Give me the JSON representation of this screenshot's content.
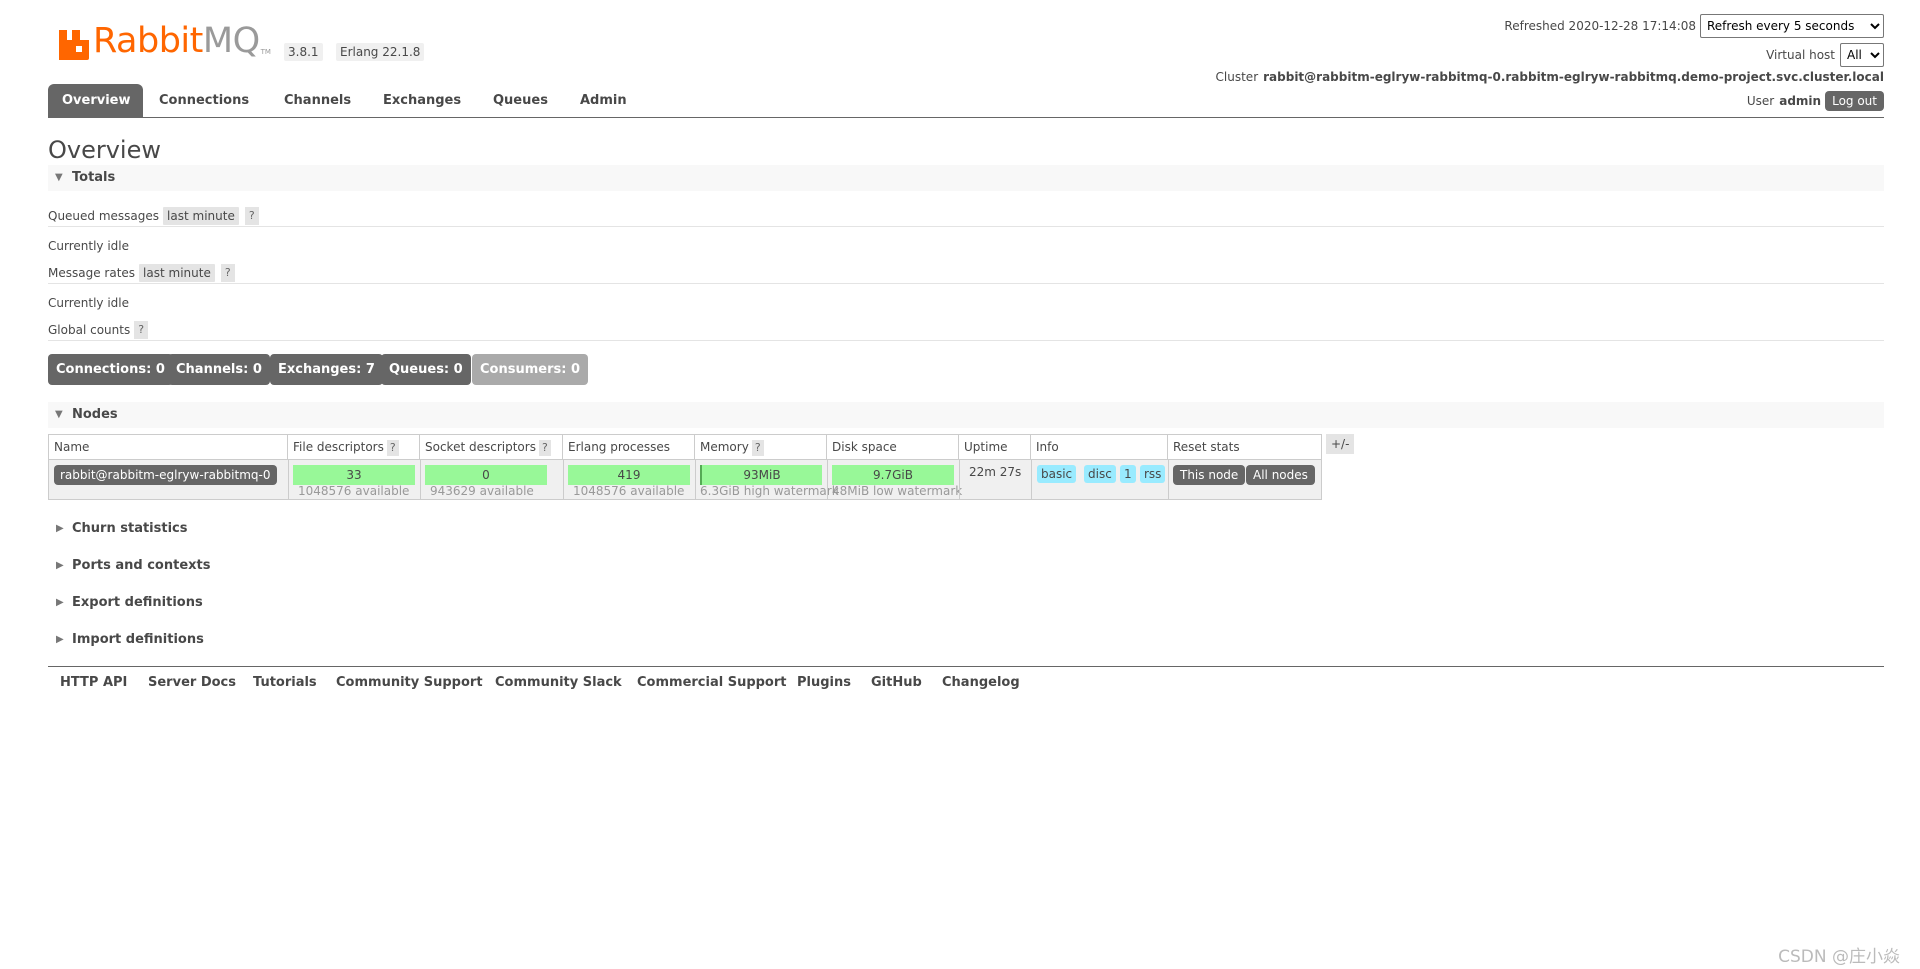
{
  "brand": {
    "word_a": "Rabbit",
    "word_b": "MQ",
    "tm": "TM",
    "color": "#ff6600"
  },
  "versions": {
    "rabbitmq": "3.8.1",
    "erlang": "Erlang 22.1.8"
  },
  "header": {
    "refreshed_label": "Refreshed 2020-12-28 17:14:08",
    "refresh_select": "Refresh every 5 seconds",
    "vhost_label": "Virtual host",
    "vhost_select": "All",
    "cluster_label": "Cluster",
    "cluster_name": "rabbit@rabbitm-eglryw-rabbitmq-0.rabbitm-eglryw-rabbitmq.demo-project.svc.cluster.local",
    "user_label": "User",
    "user_name": "admin",
    "logout_label": "Log out"
  },
  "tabs": [
    {
      "label": "Overview",
      "active": true
    },
    {
      "label": "Connections"
    },
    {
      "label": "Channels"
    },
    {
      "label": "Exchanges"
    },
    {
      "label": "Queues"
    },
    {
      "label": "Admin"
    }
  ],
  "page_title": "Overview",
  "totals": {
    "heading": "Totals",
    "queued_label": "Queued messages",
    "queued_range": "last minute",
    "help": "?",
    "queued_status": "Currently idle",
    "rates_label": "Message rates",
    "rates_range": "last minute",
    "rates_status": "Currently idle",
    "global_label": "Global counts",
    "counts": [
      "Connections: 0",
      "Channels: 0",
      "Exchanges: 7",
      "Queues: 0",
      "Consumers: 0"
    ]
  },
  "nodes": {
    "heading": "Nodes",
    "columns": [
      "Name",
      "File descriptors",
      "Socket descriptors",
      "Erlang processes",
      "Memory",
      "Disk space",
      "Uptime",
      "Info",
      "Reset stats"
    ],
    "plus_minus": "+/-",
    "row": {
      "name": "rabbit@rabbitm-eglryw-rabbitmq-0",
      "fd_used": "33",
      "fd_avail": "1048576 available",
      "sock_used": "0",
      "sock_avail": "943629 available",
      "proc_used": "419",
      "proc_avail": "1048576 available",
      "mem_used": "93MiB",
      "mem_note": "6.3GiB high watermark",
      "disk_free": "9.7GiB",
      "disk_note": "48MiB low watermark",
      "uptime": "22m 27s",
      "info": [
        "basic",
        "disc",
        "1",
        "rss"
      ],
      "reset_this": "This node",
      "reset_all": "All nodes"
    }
  },
  "collapsed_sections": [
    "Churn statistics",
    "Ports and contexts",
    "Export definitions",
    "Import definitions"
  ],
  "footer_links": [
    "HTTP API",
    "Server Docs",
    "Tutorials",
    "Community Support",
    "Community Slack",
    "Commercial Support",
    "Plugins",
    "GitHub",
    "Changelog"
  ],
  "watermark": "CSDN @庄小焱"
}
